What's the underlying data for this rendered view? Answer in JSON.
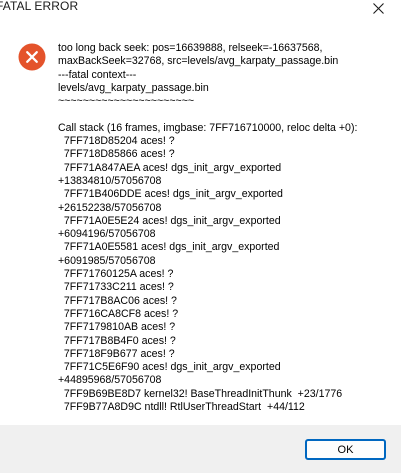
{
  "window": {
    "title": "FATAL ERROR",
    "close_icon": "close-icon"
  },
  "dialog": {
    "icon": "error-icon",
    "icon_color": "#e4532b",
    "message": "too long back seek: pos=16639888, relseek=-16637568,\nmaxBackSeek=32768, src=levels/avg_karpaty_passage.bin\n---fatal context---\nlevels/avg_karpaty_passage.bin\n~~~~~~~~~~~~~~~~~~~~~~\n\nCall stack (16 frames, imgbase: 7FF716710000, reloc delta +0):\n  7FF718D85204 aces! ?\n  7FF718D85866 aces! ?\n  7FF71A847AEA aces! dgs_init_argv_exported\n+13834810/57056708\n  7FF71B406DDE aces! dgs_init_argv_exported\n+26152238/57056708\n  7FF71A0E5E24 aces! dgs_init_argv_exported\n+6094196/57056708\n  7FF71A0E5581 aces! dgs_init_argv_exported\n+6091985/57056708\n  7FF71760125A aces! ?\n  7FF71733C211 aces! ?\n  7FF717B8AC06 aces! ?\n  7FF716CA8CF8 aces! ?\n  7FF7179810AB aces! ?\n  7FF717B8B4F0 aces! ?\n  7FF718F9B677 aces! ?\n  7FF71C5E6F90 aces! dgs_init_argv_exported\n+44895968/57056708\n  7FF9B69BE8D7 kernel32! BaseThreadInitThunk  +23/1776\n  7FF9B77A8D9C ntdll! RtlUserThreadStart  +44/112"
  },
  "footer": {
    "ok_label": "OK"
  }
}
